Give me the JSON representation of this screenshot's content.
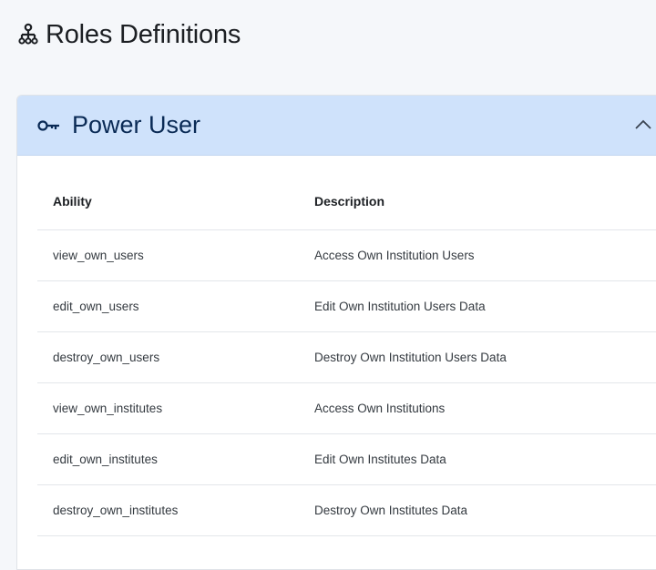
{
  "page": {
    "title": "Roles Definitions",
    "title_icon": "roles-hierarchy-icon"
  },
  "role_card": {
    "title": "Power User",
    "title_icon": "key-icon",
    "toggle_icon": "chevron-up-icon",
    "expanded": true,
    "header_color": "#cfe2fb"
  },
  "table": {
    "columns": [
      "Ability",
      "Description"
    ],
    "rows": [
      {
        "ability": "view_own_users",
        "description": "Access Own Institution Users"
      },
      {
        "ability": "edit_own_users",
        "description": "Edit Own Institution Users Data"
      },
      {
        "ability": "destroy_own_users",
        "description": "Destroy Own Institution Users Data"
      },
      {
        "ability": "view_own_institutes",
        "description": "Access Own Institutions"
      },
      {
        "ability": "edit_own_institutes",
        "description": "Edit Own Institutes Data"
      },
      {
        "ability": "destroy_own_institutes",
        "description": "Destroy Own Institutes Data"
      }
    ]
  }
}
